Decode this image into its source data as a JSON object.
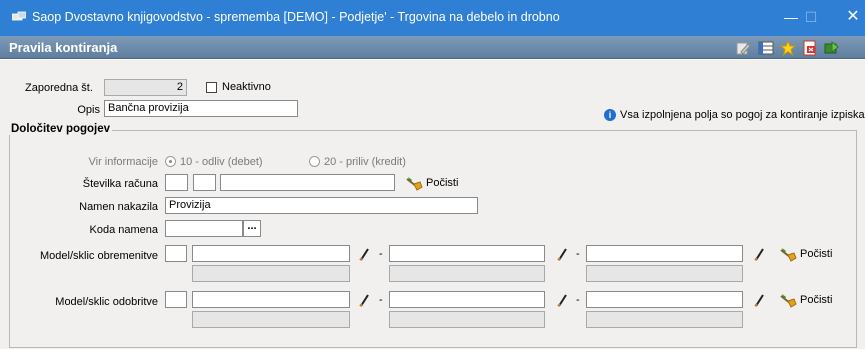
{
  "window": {
    "title": "Saop Dvostavno knjigovodstvo - sprememba [DEMO] - Podjetje' - Trgovina na debelo in drobno",
    "min": "—",
    "max": "☐",
    "close": "✕"
  },
  "header": {
    "title": "Pravila kontiranja"
  },
  "form": {
    "zaporedna_label": "Zaporedna št.",
    "zaporedna_value": "2",
    "neaktivno_label": "Neaktivno",
    "opis_label": "Opis",
    "opis_value": "Bančna provizija",
    "info_text": "Vsa izpolnjena polja so pogoj za kontiranje izpiska."
  },
  "group": {
    "title": "Določitev pogojev",
    "vir_label": "Vir informacije",
    "radio1_label": "10 - odliv (debet)",
    "radio2_label": "20 - priliv (kredit)",
    "stevilka_label": "Številka računa",
    "namen_label": "Namen nakazila",
    "namen_value": "Provizija",
    "koda_label": "Koda namena",
    "model_obr_label": "Model/sklic obremenitve",
    "model_odo_label": "Model/sklic odobritve",
    "clear_label": "Počisti",
    "dash": "-",
    "dots": "..."
  },
  "colors": {
    "titlebar": "#2f7fd4",
    "header": "#6e8cab",
    "info": "#1d6fd1"
  }
}
